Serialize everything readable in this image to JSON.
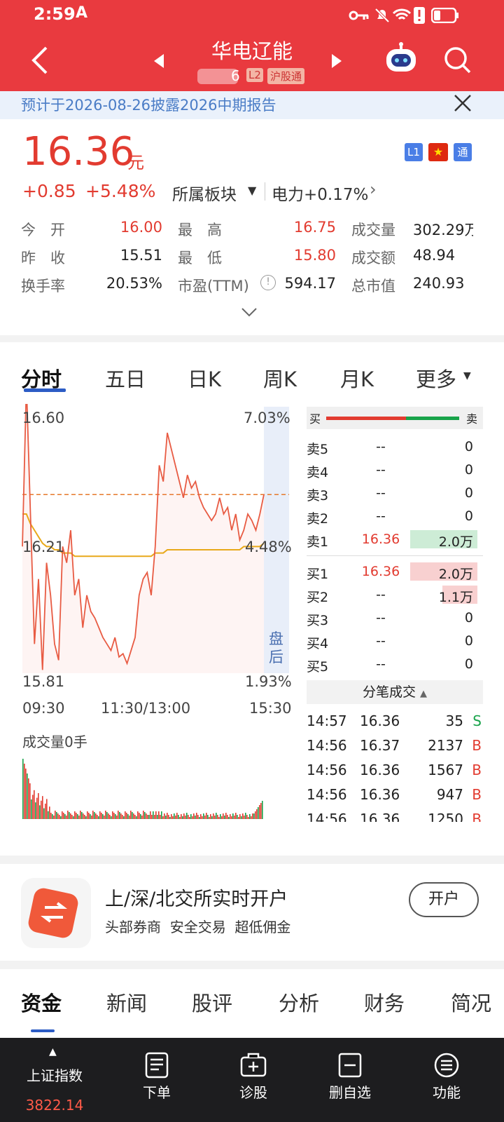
{
  "status": {
    "time": "2:59",
    "app_glyph": "A",
    "battery": "low"
  },
  "header": {
    "title": "华电辽能",
    "code": "6",
    "badge_l2": "L2",
    "badge_hgt": "沪股通"
  },
  "banner": {
    "text": "预计于2026-08-26披露2026中期报告"
  },
  "quote": {
    "price": "16.36",
    "unit": "元",
    "change": "+0.85",
    "change_pct": "+5.48%",
    "sector_label": "所属板块",
    "sector_value": "电力+0.17%",
    "badges": {
      "l1": "L1",
      "tong": "通"
    },
    "rows": [
      [
        {
          "label": "今　开",
          "value": "16.00",
          "tone": "red"
        },
        {
          "label": "最　高",
          "value": "16.75",
          "tone": "red"
        },
        {
          "label": "成交量",
          "value": "302.29万"
        }
      ],
      [
        {
          "label": "昨　收",
          "value": "15.51",
          "tone": ""
        },
        {
          "label": "最　低",
          "value": "15.80",
          "tone": "red"
        },
        {
          "label": "成交额",
          "value": "48.94"
        }
      ],
      [
        {
          "label": "换手率",
          "value": "20.53%",
          "tone": ""
        },
        {
          "label": "市盈(TTM)",
          "value": "594.17",
          "tone": ""
        },
        {
          "label": "总市值",
          "value": "240.93"
        }
      ]
    ]
  },
  "chart_tabs": [
    "分时",
    "五日",
    "日K",
    "周K",
    "月K",
    "更多"
  ],
  "chart_data": {
    "type": "line",
    "y_left_ticks": [
      "16.60",
      "16.21",
      "15.81"
    ],
    "y_right_ticks": [
      "7.03%",
      "4.48%",
      "1.93%"
    ],
    "x_ticks": [
      "09:30",
      "11:30/13:00",
      "15:30"
    ],
    "after_hours_label": "盘后",
    "prev_close": 16.36,
    "price_series": [
      16.2,
      16.7,
      16.3,
      15.9,
      16.1,
      15.82,
      16.15,
      16.05,
      15.9,
      15.85,
      16.2,
      16.15,
      16.25,
      16.05,
      16.1,
      15.95,
      16.05,
      16.0,
      15.98,
      15.95,
      15.92,
      15.9,
      15.88,
      15.92,
      15.86,
      15.87,
      15.84,
      15.88,
      15.92,
      16.05,
      16.1,
      16.12,
      16.05,
      16.2,
      16.45,
      16.4,
      16.55,
      16.5,
      16.45,
      16.4,
      16.35,
      16.42,
      16.38,
      16.4,
      16.35,
      16.32,
      16.3,
      16.28,
      16.3,
      16.35,
      16.3,
      16.32,
      16.25,
      16.3,
      16.22,
      16.25,
      16.3,
      16.28,
      16.25,
      16.3,
      16.36
    ],
    "avg_series": [
      16.3,
      16.3,
      16.27,
      16.25,
      16.23,
      16.21,
      16.2,
      16.2,
      16.19,
      16.19,
      16.18,
      16.18,
      16.18,
      16.17,
      16.17,
      16.17,
      16.17,
      16.17,
      16.17,
      16.17,
      16.17,
      16.17,
      16.17,
      16.17,
      16.17,
      16.17,
      16.17,
      16.17,
      16.17,
      16.17,
      16.17,
      16.17,
      16.17,
      16.18,
      16.18,
      16.18,
      16.19,
      16.19,
      16.19,
      16.19,
      16.19,
      16.19,
      16.19,
      16.19,
      16.19,
      16.19,
      16.19,
      16.19,
      16.19,
      16.19,
      16.19,
      16.19,
      16.19,
      16.19,
      16.19,
      16.2,
      16.2,
      16.2,
      16.2,
      16.2,
      16.21
    ],
    "y_range": [
      15.81,
      16.6
    ],
    "volume_label": "成交量0手"
  },
  "orderbook": {
    "header_buy": "买",
    "header_sell": "卖",
    "asks": [
      {
        "label": "卖5",
        "price": "--",
        "vol": "0"
      },
      {
        "label": "卖4",
        "price": "--",
        "vol": "0"
      },
      {
        "label": "卖3",
        "price": "--",
        "vol": "0"
      },
      {
        "label": "卖2",
        "price": "--",
        "vol": "0"
      },
      {
        "label": "卖1",
        "price": "16.36",
        "vol": "2.0万"
      }
    ],
    "bids": [
      {
        "label": "买1",
        "price": "16.36",
        "vol": "2.0万"
      },
      {
        "label": "买2",
        "price": "--",
        "vol": "1.1万"
      },
      {
        "label": "买3",
        "price": "--",
        "vol": "0"
      },
      {
        "label": "买4",
        "price": "--",
        "vol": "0"
      },
      {
        "label": "买5",
        "price": "--",
        "vol": "0"
      }
    ],
    "ticks_title": "分笔成交",
    "ticks": [
      {
        "time": "14:57",
        "price": "16.36",
        "vol": "35",
        "side": "S"
      },
      {
        "time": "14:56",
        "price": "16.37",
        "vol": "2137",
        "side": "B"
      },
      {
        "time": "14:56",
        "price": "16.36",
        "vol": "1567",
        "side": "B"
      },
      {
        "time": "14:56",
        "price": "16.36",
        "vol": "947",
        "side": "B"
      },
      {
        "time": "14:56",
        "price": "16.36",
        "vol": "1250",
        "side": "B"
      }
    ]
  },
  "promo": {
    "title": "上/深/北交所实时开户",
    "sub": "头部券商  安全交易  超低佣金",
    "button": "开户"
  },
  "info_tabs": [
    "资金",
    "新闻",
    "股评",
    "分析",
    "财务",
    "简况"
  ],
  "bottom_nav": {
    "index_name": "上证指数",
    "index_value": "3822.14",
    "items": [
      "下单",
      "诊股",
      "删自选",
      "功能"
    ]
  }
}
